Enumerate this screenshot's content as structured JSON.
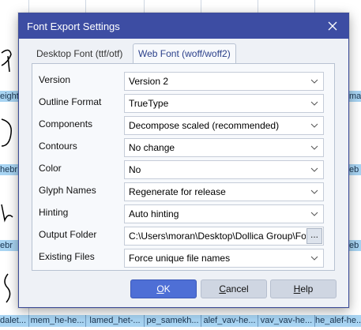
{
  "background": {
    "row_labels_left": [
      "eight",
      "hebr",
      "ebr",
      "alet"
    ],
    "row_labels_right": [
      "mat",
      "eb",
      "eb",
      "eb"
    ],
    "bottom_labels": [
      "dalet...",
      "mem_he-he...",
      "lamed_het-...",
      "pe_samekh...",
      "alef_vav-he...",
      "vav_vav-he...",
      "he_alef-he..."
    ]
  },
  "dialog": {
    "title": "Font Export Settings",
    "close_icon": "close-icon",
    "tabs": [
      {
        "label": "Desktop Font (ttf/otf)",
        "active": false
      },
      {
        "label": "Web Font (woff/woff2)",
        "active": true
      }
    ],
    "fields": [
      {
        "label": "Version",
        "value": "Version 2"
      },
      {
        "label": "Outline Format",
        "value": "TrueType"
      },
      {
        "label": "Components",
        "value": "Decompose scaled (recommended)"
      },
      {
        "label": "Contours",
        "value": "No change"
      },
      {
        "label": "Color",
        "value": "No"
      },
      {
        "label": "Glyph Names",
        "value": "Regenerate for release"
      },
      {
        "label": "Hinting",
        "value": "Auto hinting"
      }
    ],
    "output_folder": {
      "label": "Output Folder",
      "value": "C:\\Users\\moran\\Desktop\\Dollica Group\\Fonts",
      "browse_label": "..."
    },
    "existing_files": {
      "label": "Existing Files",
      "value": "Force unique file names"
    },
    "buttons": {
      "ok": {
        "mnemonic": "O",
        "rest": "K"
      },
      "cancel": {
        "mnemonic": "C",
        "rest": "ancel"
      },
      "help": {
        "mnemonic": "H",
        "rest": "elp"
      }
    },
    "colors": {
      "titlebar": "#3d4da3",
      "primary_button": "#4e6fd6",
      "dialog_bg": "#eef1f6"
    }
  }
}
